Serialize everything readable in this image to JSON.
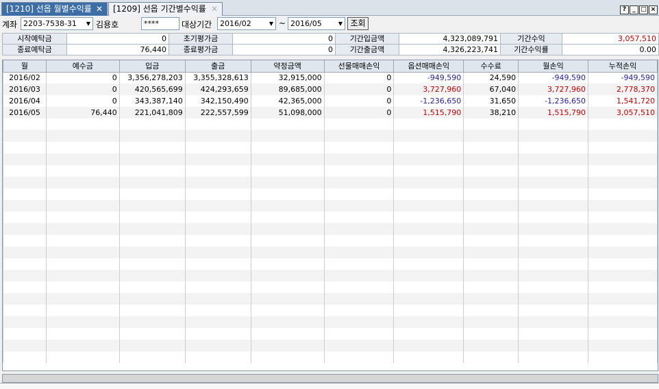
{
  "tabs": [
    {
      "label": "[1210] 선옵 월별수익률",
      "close": "✕"
    },
    {
      "label": "[1209] 선옵 기간별수익률",
      "close": "✕"
    }
  ],
  "window_buttons": [
    "?",
    "_",
    "□",
    "×"
  ],
  "toolbar": {
    "account_label": "계좌",
    "account_value": "2203-7538-31",
    "account_name": "김용호",
    "password_mask": "****",
    "period_label": "대상기간",
    "from": "2016/02",
    "tilde": "~",
    "to": "2016/05",
    "query_label": "조회",
    "dropdown_arrow": "▼"
  },
  "summary": {
    "row1": {
      "h1": "시작예탁금",
      "v1": "0",
      "h2": "초기평가금",
      "v2": "0",
      "h3": "기간입금액",
      "v3": "4,323,089,791",
      "h4": "기간수익",
      "v4": "3,057,510"
    },
    "row2": {
      "h1": "종료예탁금",
      "v1": "76,440",
      "h2": "종료평가금",
      "v2": "0",
      "h3": "기간출금액",
      "v3": "4,326,223,741",
      "h4": "기간수익률",
      "v4": "0.00"
    },
    "colors": {
      "profit": "#c00000",
      "loss": "#1f1fa0"
    }
  },
  "grid": {
    "headers": [
      "월",
      "예수금",
      "입금",
      "출금",
      "약정금액",
      "선물매매손익",
      "옵션매매손익",
      "수수료",
      "월손익",
      "누적손익"
    ],
    "rows": [
      [
        "2016/02",
        "0",
        "3,356,278,203",
        "3,355,328,613",
        "32,915,000",
        "0",
        "-949,590",
        "24,590",
        "-949,590",
        "-949,590"
      ],
      [
        "2016/03",
        "0",
        "420,565,699",
        "424,293,659",
        "89,685,000",
        "0",
        "3,727,960",
        "67,040",
        "3,727,960",
        "2,778,370"
      ],
      [
        "2016/04",
        "0",
        "343,387,140",
        "342,150,490",
        "42,365,000",
        "0",
        "-1,236,650",
        "31,650",
        "-1,236,650",
        "1,541,720"
      ],
      [
        "2016/05",
        "76,440",
        "221,041,809",
        "222,557,599",
        "51,098,000",
        "0",
        "1,515,790",
        "38,210",
        "1,515,790",
        "3,057,510"
      ]
    ],
    "empty_rows": 21
  }
}
